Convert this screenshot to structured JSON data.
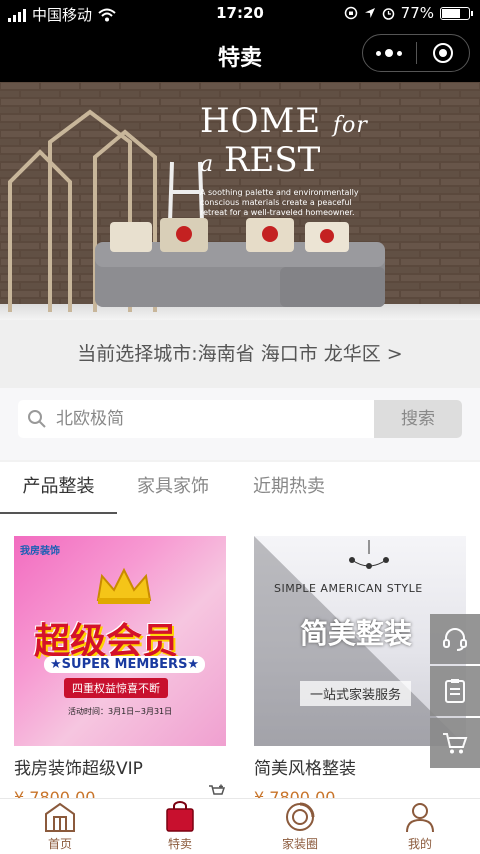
{
  "status_bar": {
    "carrier": "中国移动",
    "time": "17:20",
    "battery": "77%",
    "battery_level": 0.77
  },
  "nav": {
    "title": "特卖"
  },
  "banner": {
    "headline_1": "HOME",
    "headline_for": "for",
    "headline_a": "a",
    "headline_2": "REST",
    "description": "A soothing palette and environmentally conscious materials create a peaceful retreat for a well-traveled homeowner."
  },
  "city": {
    "text": "当前选择城市:海南省 海口市 龙华区 >"
  },
  "search": {
    "placeholder": "北欧极简",
    "button": "搜索"
  },
  "tabs": [
    {
      "label": "产品整装",
      "active": true
    },
    {
      "label": "家具家饰",
      "active": false
    },
    {
      "label": "近期热卖",
      "active": false
    }
  ],
  "products": [
    {
      "name": "我房装饰超级VIP",
      "price": "¥ 7800.00",
      "image": {
        "brand": "我房装饰",
        "big_text": "超级会员",
        "members": "★SUPER MEMBERS★",
        "red_text": "四重权益惊喜不断",
        "date": "活动时间：3月1日~3月31日"
      }
    },
    {
      "name": "简美风格整装",
      "price": "¥ 7800.00",
      "image": {
        "tagline": "SIMPLE AMERICAN STYLE",
        "heading": "简美整装",
        "sub": "一站式家装服务"
      }
    }
  ],
  "side_buttons": [
    "headset-icon",
    "clipboard-icon",
    "cart-icon"
  ],
  "tabbar": [
    {
      "label": "首页",
      "icon": "home-icon"
    },
    {
      "label": "特卖",
      "icon": "bag-icon"
    },
    {
      "label": "家装圈",
      "icon": "circle-icon"
    },
    {
      "label": "我的",
      "icon": "user-icon"
    }
  ],
  "colors": {
    "accent": "#8b5a3c",
    "active_tab_icon": "#c8102e",
    "price": "#c8742a"
  }
}
